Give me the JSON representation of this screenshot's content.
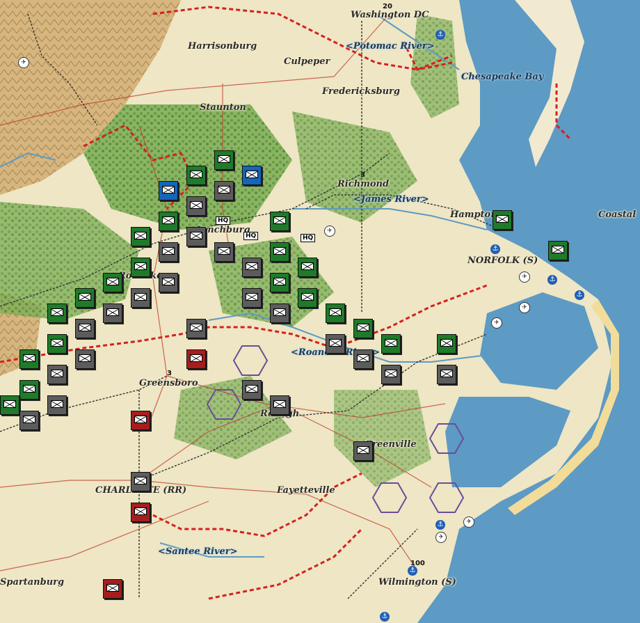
{
  "map": {
    "cities": [
      {
        "name": "Washington DC"
      },
      {
        "name": "Harrisonburg"
      },
      {
        "name": "Culpeper"
      },
      {
        "name": "Fredericksburg"
      },
      {
        "name": "Staunton"
      },
      {
        "name": "Richmond"
      },
      {
        "name": "Lynchburg"
      },
      {
        "name": "Roanoke"
      },
      {
        "name": "Hampton"
      },
      {
        "name": "NORFOLK (S)"
      },
      {
        "name": "Coastal"
      },
      {
        "name": "Greensboro"
      },
      {
        "name": "Raleigh"
      },
      {
        "name": "Greenville"
      },
      {
        "name": "CHARLOTTE (RR)"
      },
      {
        "name": "Fayetteville"
      },
      {
        "name": "Spartanburg"
      },
      {
        "name": "Wilmington (S)"
      }
    ],
    "water": [
      {
        "name": "<Potomac River>"
      },
      {
        "name": "Chesapeake Bay"
      },
      {
        "name": "<James River>"
      },
      {
        "name": "<Roanoke River>"
      },
      {
        "name": "<Santee River>"
      }
    ],
    "badges": {
      "dc": "20",
      "richmond": "3",
      "greensboro": "3",
      "wilmington": "100"
    },
    "hq_label": "HQ",
    "colors": {
      "land": "#efe8c8",
      "forest": "#6da04a",
      "mountain": "#c9a66b",
      "sea": "#5d9ac4",
      "front": "#d4201f",
      "rail": "#333333",
      "road": "#c0392b"
    }
  }
}
